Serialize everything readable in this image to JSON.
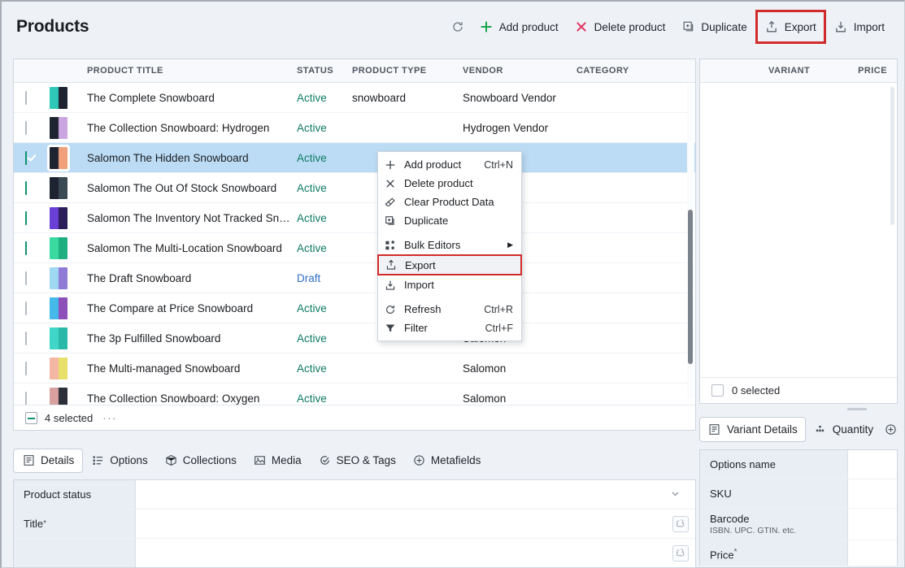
{
  "header": {
    "title": "Products"
  },
  "toolbar": {
    "refresh_label": "",
    "items": [
      {
        "label": "",
        "icon": "refresh-icon",
        "name": "refresh-button"
      },
      {
        "label": "Add product",
        "icon": "plus-icon",
        "name": "add-product-button"
      },
      {
        "label": "Delete product",
        "icon": "close-x-icon",
        "name": "delete-product-button"
      },
      {
        "label": "Duplicate",
        "icon": "duplicate-icon",
        "name": "duplicate-button"
      },
      {
        "label": "Export",
        "icon": "export-icon",
        "name": "export-button"
      },
      {
        "label": "Import",
        "icon": "import-icon",
        "name": "import-button"
      }
    ],
    "highlight_color": "#d22b2b"
  },
  "grid": {
    "columns": [
      "PRODUCT TITLE",
      "STATUS",
      "PRODUCT TYPE",
      "VENDOR",
      "CATEGORY"
    ],
    "rows": [
      {
        "checked": false,
        "title": "The Complete Snowboard",
        "status": "Active",
        "type": "snowboard",
        "vendor": "Snowboard Vendor",
        "category": "",
        "thumb1": "#2ec7b8",
        "thumb2": "#1d2330"
      },
      {
        "checked": false,
        "title": "The Collection Snowboard: Hydrogen",
        "status": "Active",
        "type": "",
        "vendor": "Hydrogen Vendor",
        "category": "",
        "thumb1": "#1d2330",
        "thumb2": "#c9a6e0"
      },
      {
        "checked": true,
        "title": "Salomon The Hidden Snowboard",
        "status": "Active",
        "type": "",
        "vendor": "",
        "category": "",
        "thumb1": "#1d2330",
        "thumb2": "#f0a07a",
        "selected": true
      },
      {
        "checked": true,
        "title": "Salomon The Out Of Stock Snowboard",
        "status": "Active",
        "type": "",
        "vendor": "",
        "category": "",
        "thumb1": "#1d2330",
        "thumb2": "#3a4a55"
      },
      {
        "checked": true,
        "title": "Salomon The Inventory Not Tracked Sno...",
        "status": "Active",
        "type": "",
        "vendor": "",
        "category": "",
        "thumb1": "#6a3fd6",
        "thumb2": "#2b1d58"
      },
      {
        "checked": true,
        "title": "Salomon The Multi-Location Snowboard",
        "status": "Active",
        "type": "",
        "vendor": "",
        "category": "",
        "thumb1": "#3ad9a0",
        "thumb2": "#1fae80"
      },
      {
        "checked": false,
        "title": "The Draft Snowboard",
        "status": "Draft",
        "type": "",
        "vendor": "",
        "category": "",
        "thumb1": "#9fd8f2",
        "thumb2": "#8f7ad6"
      },
      {
        "checked": false,
        "title": "The Compare at Price Snowboard",
        "status": "Active",
        "type": "",
        "vendor": "",
        "category": "",
        "thumb1": "#44b9ea",
        "thumb2": "#8e4fb8"
      },
      {
        "checked": false,
        "title": "The 3p Fulfilled Snowboard",
        "status": "Active",
        "type": "",
        "vendor": "Salomon",
        "category": "",
        "thumb1": "#3fd6c8",
        "thumb2": "#2ab9a8"
      },
      {
        "checked": false,
        "title": "The Multi-managed Snowboard",
        "status": "Active",
        "type": "",
        "vendor": "Salomon",
        "category": "",
        "thumb1": "#f3b7a4",
        "thumb2": "#e8e06a"
      },
      {
        "checked": false,
        "title": "The Collection Snowboard: Oxygen",
        "status": "Active",
        "type": "",
        "vendor": "Salomon",
        "category": "",
        "thumb1": "#d9a0a0",
        "thumb2": "#2a2f3a"
      }
    ],
    "status_colors": {
      "active": "#0e7a63",
      "draft": "#2f6fc4"
    },
    "selection_summary": "4 selected",
    "more_glyph": "···"
  },
  "context_menu": {
    "items": [
      {
        "label": "Add product",
        "shortcut": "Ctrl+N",
        "icon": "plus-icon",
        "name": "menu-add-product"
      },
      {
        "label": "Delete product",
        "shortcut": "",
        "icon": "close-x-icon",
        "name": "menu-delete-product"
      },
      {
        "label": "Clear Product Data",
        "shortcut": "",
        "icon": "eraser-icon",
        "name": "menu-clear-product-data"
      },
      {
        "label": "Duplicate",
        "shortcut": "",
        "icon": "duplicate-icon",
        "name": "menu-duplicate"
      },
      {
        "label": "Bulk Editors",
        "shortcut": "",
        "icon": "bulk-icon",
        "name": "menu-bulk-editors",
        "submenu": true
      },
      {
        "label": "Export",
        "shortcut": "",
        "icon": "export-icon",
        "name": "menu-export",
        "highlighted": true
      },
      {
        "label": "Import",
        "shortcut": "",
        "icon": "import-icon",
        "name": "menu-import"
      },
      {
        "label": "Refresh",
        "shortcut": "Ctrl+R",
        "icon": "refresh-icon",
        "name": "menu-refresh"
      },
      {
        "label": "Filter",
        "shortcut": "Ctrl+F",
        "icon": "filter-icon",
        "name": "menu-filter"
      }
    ],
    "submenu_arrow": "▶"
  },
  "bottom_tabs": [
    {
      "label": "Details",
      "icon": "details-icon",
      "active": true
    },
    {
      "label": "Options",
      "icon": "options-icon",
      "active": false
    },
    {
      "label": "Collections",
      "icon": "collections-icon",
      "active": false
    },
    {
      "label": "Media",
      "icon": "media-icon",
      "active": false
    },
    {
      "label": "SEO & Tags",
      "icon": "seo-icon",
      "active": false
    },
    {
      "label": "Metafields",
      "icon": "metafields-icon",
      "active": false
    }
  ],
  "details_form": {
    "rows": [
      {
        "label": "Product status",
        "required": false,
        "value": "",
        "control": "dropdown"
      },
      {
        "label": "Title",
        "required": true,
        "value": "",
        "control": "ai"
      },
      {
        "label": "",
        "required": false,
        "value": "",
        "control": "ai"
      }
    ],
    "required_marker": "*"
  },
  "right_panel": {
    "columns": [
      "VARIANT",
      "PRICE"
    ],
    "rows": [],
    "selection_summary": "0 selected"
  },
  "right_tabs": [
    {
      "label": "Variant Details",
      "icon": "details-icon",
      "active": true
    },
    {
      "label": "Quantity",
      "icon": "quantity-icon",
      "active": false
    },
    {
      "label": "",
      "icon": "metafields-icon",
      "active": false
    }
  ],
  "variant_form": {
    "rows": [
      {
        "label": "Options name",
        "sub": "",
        "required": false,
        "value": ""
      },
      {
        "label": "SKU",
        "sub": "",
        "required": false,
        "value": ""
      },
      {
        "label": "Barcode",
        "sub": "ISBN. UPC. GTIN. etc.",
        "required": false,
        "value": ""
      },
      {
        "label": "Price",
        "sub": "",
        "required": true,
        "value": ""
      }
    ],
    "required_marker": "*"
  }
}
